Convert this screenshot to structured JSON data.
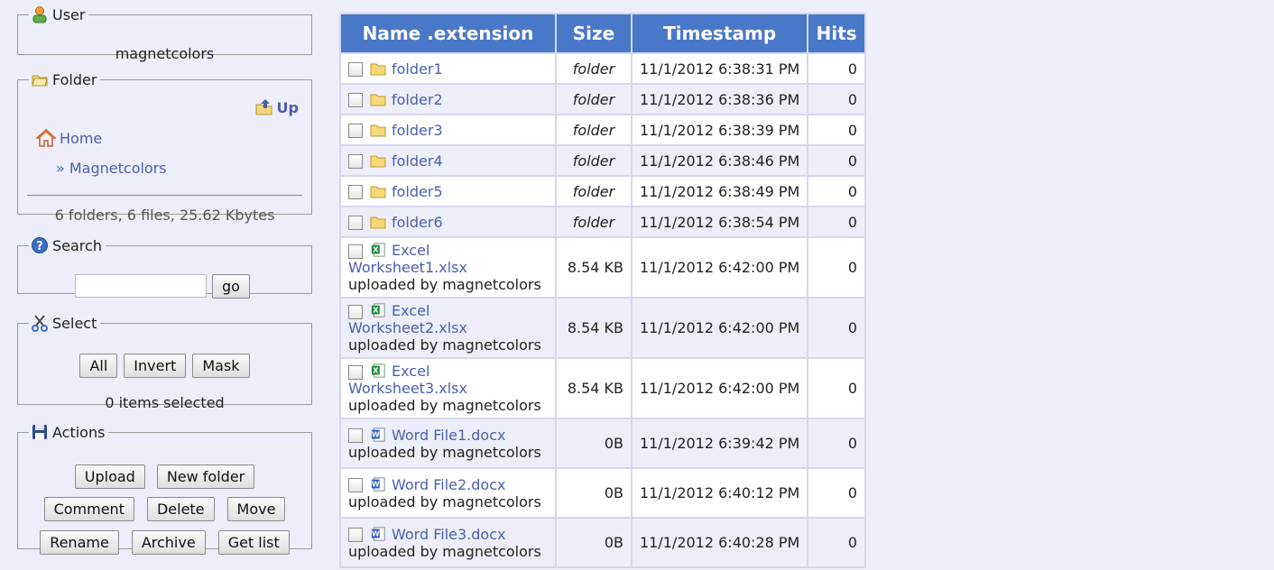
{
  "user": {
    "legend": "User",
    "name": "magnetcolors"
  },
  "folder": {
    "legend": "Folder",
    "up_label": "Up",
    "home_label": "Home",
    "crumb": "» Magnetcolors",
    "stats": "6 folders, 6 files, 25.62 Kbytes"
  },
  "search": {
    "legend": "Search",
    "value": "",
    "go_label": "go"
  },
  "select": {
    "legend": "Select",
    "all_label": "All",
    "invert_label": "Invert",
    "mask_label": "Mask",
    "info": "0 items selected"
  },
  "actions": {
    "legend": "Actions",
    "upload": "Upload",
    "new_folder": "New folder",
    "comment": "Comment",
    "delete": "Delete",
    "move": "Move",
    "rename": "Rename",
    "archive": "Archive",
    "get_list": "Get list"
  },
  "table": {
    "headers": {
      "name": "Name .extension",
      "size": "Size",
      "timestamp": "Timestamp",
      "hits": "Hits"
    },
    "rows": [
      {
        "type": "folder",
        "name": "folder1",
        "size": "folder",
        "timestamp": "11/1/2012 6:38:31 PM",
        "hits": "0",
        "uploader": ""
      },
      {
        "type": "folder",
        "name": "folder2",
        "size": "folder",
        "timestamp": "11/1/2012 6:38:36 PM",
        "hits": "0",
        "uploader": ""
      },
      {
        "type": "folder",
        "name": "folder3",
        "size": "folder",
        "timestamp": "11/1/2012 6:38:39 PM",
        "hits": "0",
        "uploader": ""
      },
      {
        "type": "folder",
        "name": "folder4",
        "size": "folder",
        "timestamp": "11/1/2012 6:38:46 PM",
        "hits": "0",
        "uploader": ""
      },
      {
        "type": "folder",
        "name": "folder5",
        "size": "folder",
        "timestamp": "11/1/2012 6:38:49 PM",
        "hits": "0",
        "uploader": ""
      },
      {
        "type": "folder",
        "name": "folder6",
        "size": "folder",
        "timestamp": "11/1/2012 6:38:54 PM",
        "hits": "0",
        "uploader": ""
      },
      {
        "type": "excel",
        "name": "Excel Worksheet1.xlsx",
        "size": "8.54 KB",
        "timestamp": "11/1/2012 6:42:00 PM",
        "hits": "0",
        "uploader": "uploaded by magnetcolors"
      },
      {
        "type": "excel",
        "name": "Excel Worksheet2.xlsx",
        "size": "8.54 KB",
        "timestamp": "11/1/2012 6:42:00 PM",
        "hits": "0",
        "uploader": "uploaded by magnetcolors"
      },
      {
        "type": "excel",
        "name": "Excel Worksheet3.xlsx",
        "size": "8.54 KB",
        "timestamp": "11/1/2012 6:42:00 PM",
        "hits": "0",
        "uploader": "uploaded by magnetcolors"
      },
      {
        "type": "word",
        "name": "Word File1.docx",
        "size": "0B",
        "timestamp": "11/1/2012 6:39:42 PM",
        "hits": "0",
        "uploader": "uploaded by magnetcolors"
      },
      {
        "type": "word",
        "name": "Word File2.docx",
        "size": "0B",
        "timestamp": "11/1/2012 6:40:12 PM",
        "hits": "0",
        "uploader": "uploaded by magnetcolors"
      },
      {
        "type": "word",
        "name": "Word File3.docx",
        "size": "0B",
        "timestamp": "11/1/2012 6:40:28 PM",
        "hits": "0",
        "uploader": "uploaded by magnetcolors"
      }
    ]
  },
  "colors": {
    "header_bg": "#4a78c9",
    "link": "#4a5fb0",
    "page_bg": "#eeeefa"
  }
}
